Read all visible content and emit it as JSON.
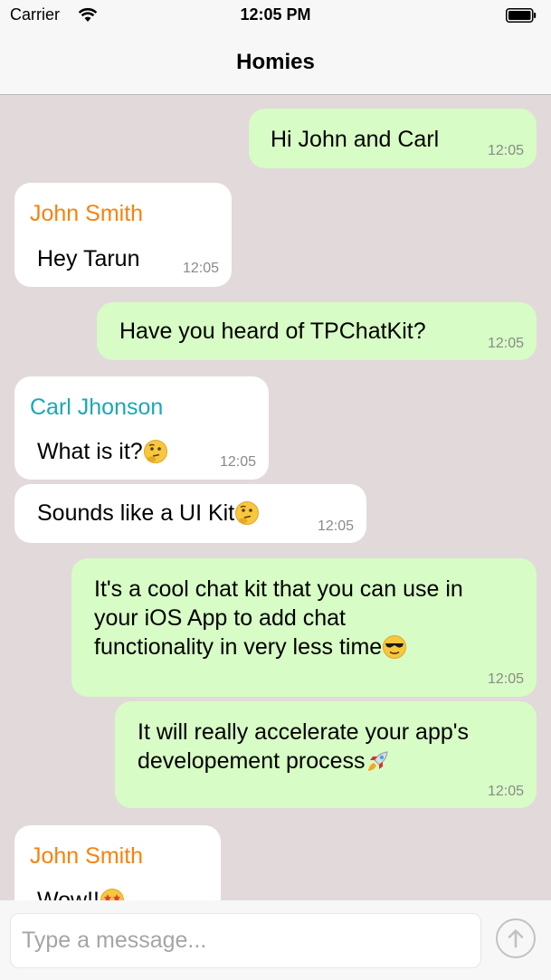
{
  "status_bar": {
    "carrier": "Carrier",
    "time": "12:05 PM"
  },
  "nav": {
    "title": "Homies"
  },
  "colors": {
    "outgoing_bubble": "#d7fcc5",
    "incoming_bubble": "#ffffff",
    "background": "#e2d9db",
    "john_name": "#f7820f",
    "carl_name": "#1aa8b8"
  },
  "messages": [
    {
      "direction": "outgoing",
      "text": "Hi John and Carl",
      "time": "12:05"
    },
    {
      "direction": "incoming",
      "sender": "John Smith",
      "text": "Hey Tarun",
      "time": "12:05"
    },
    {
      "direction": "outgoing",
      "text": "Have you heard of TPChatKit?",
      "time": "12:05"
    },
    {
      "direction": "incoming",
      "sender": "Carl Jhonson",
      "text": "What is it?",
      "emoji": "thinking-face",
      "time": "12:05"
    },
    {
      "direction": "incoming",
      "text": "Sounds like a UI Kit",
      "emoji": "thinking-face",
      "time": "12:05"
    },
    {
      "direction": "outgoing",
      "text": "It's a cool chat kit that you can use in\nyour iOS App to add chat\nfunctionality in very less time",
      "emoji": "sunglasses-face",
      "time": "12:05"
    },
    {
      "direction": "outgoing",
      "text": "It will really accelerate your app's\ndevelopement process",
      "emoji": "rocket",
      "time": "12:05"
    },
    {
      "direction": "incoming",
      "sender": "John Smith",
      "text": "Wow!!",
      "emoji": "star-struck-face"
    }
  ],
  "input": {
    "placeholder": "Type a message..."
  },
  "icons": {
    "wifi": "wifi-icon",
    "battery": "battery-icon",
    "send": "send-arrow-icon"
  }
}
